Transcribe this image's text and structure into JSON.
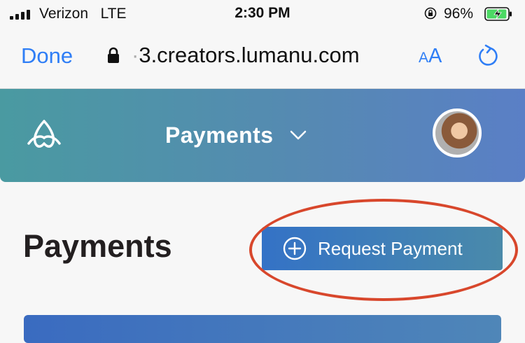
{
  "status_bar": {
    "carrier": "Verizon",
    "network": "LTE",
    "time": "2:30 PM",
    "battery_percent": "96%",
    "battery_level": 0.96,
    "icons": [
      "signal-icon",
      "rotation-lock-icon",
      "battery-charging-icon"
    ]
  },
  "browser": {
    "done_label": "Done",
    "url_faded": "·",
    "url": "3.creators.lumanu.com",
    "text_size_small": "A",
    "text_size_big": "A",
    "icons": [
      "lock-icon",
      "reload-icon"
    ]
  },
  "app_header": {
    "title": "Payments",
    "icons": [
      "lumanu-logo-icon",
      "chevron-down-icon",
      "avatar"
    ]
  },
  "main": {
    "title": "Payments",
    "request_button_label": "Request Payment",
    "icons": [
      "plus-circle-icon"
    ]
  },
  "colors": {
    "ios_blue": "#2f7ef6",
    "header_gradient_start": "#4a9aa1",
    "header_gradient_end": "#5a7fc6",
    "button_gradient_start": "#3472c6",
    "button_gradient_end": "#4a8aaa",
    "highlight_red": "#d8472c",
    "battery_green": "#4cd964"
  }
}
